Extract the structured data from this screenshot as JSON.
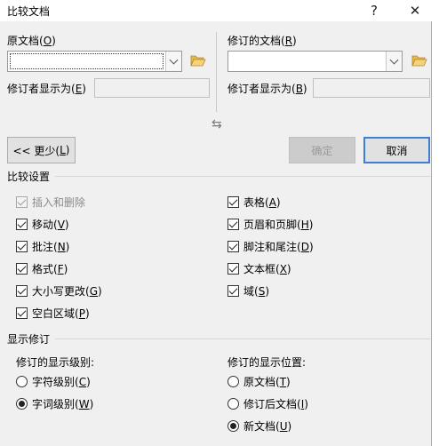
{
  "window": {
    "title": "比较文档",
    "help": "?",
    "close": "✕"
  },
  "original": {
    "label": "原文档(",
    "label_key": "O",
    "label_end": ")",
    "value": "",
    "display_as_label": "修订者显示为(",
    "display_as_key": "E",
    "display_as_value": ""
  },
  "revised": {
    "label": "修订的文档(",
    "label_key": "R",
    "label_end": ")",
    "value": "",
    "display_as_label": "修订者显示为(",
    "display_as_key": "B",
    "display_as_value": ""
  },
  "swap_icon": "⇆",
  "buttons": {
    "less_label": "<< 更少(",
    "less_key": "L",
    "less_end": ")",
    "ok_label": "确定",
    "cancel_label": "取消"
  },
  "settings": {
    "title": "比较设置",
    "left": [
      {
        "text": "插入和删除",
        "key": "",
        "checked": true,
        "disabled": true
      },
      {
        "text": "移动(",
        "key": "V",
        "end": ")",
        "checked": true
      },
      {
        "text": "批注(",
        "key": "N",
        "end": ")",
        "checked": true
      },
      {
        "text": "格式(",
        "key": "F",
        "end": ")",
        "checked": true
      },
      {
        "text": "大小写更改(",
        "key": "G",
        "end": ")",
        "checked": true
      },
      {
        "text": "空白区域(",
        "key": "P",
        "end": ")",
        "checked": true
      }
    ],
    "right": [
      {
        "text": "表格(",
        "key": "A",
        "end": ")",
        "checked": true
      },
      {
        "text": "页眉和页脚(",
        "key": "H",
        "end": ")",
        "checked": true
      },
      {
        "text": "脚注和尾注(",
        "key": "D",
        "end": ")",
        "checked": true
      },
      {
        "text": "文本框(",
        "key": "X",
        "end": ")",
        "checked": true
      },
      {
        "text": "域(",
        "key": "S",
        "end": ")",
        "checked": true
      }
    ]
  },
  "show_changes": {
    "title": "显示修订",
    "level_label": "修订的显示级别:",
    "level_options": [
      {
        "text": "字符级别(",
        "key": "C",
        "end": ")",
        "selected": false
      },
      {
        "text": "字词级别(",
        "key": "W",
        "end": ")",
        "selected": true
      }
    ],
    "location_label": "修订的显示位置:",
    "location_options": [
      {
        "text": "原文档(",
        "key": "T",
        "end": ")",
        "selected": false
      },
      {
        "text": "修订后文档(",
        "key": "I",
        "end": ")",
        "selected": false
      },
      {
        "text": "新文档(",
        "key": "U",
        "end": ")",
        "selected": true
      }
    ]
  },
  "background_edge": [
    "",
    "",
    "",
    "",
    ""
  ]
}
